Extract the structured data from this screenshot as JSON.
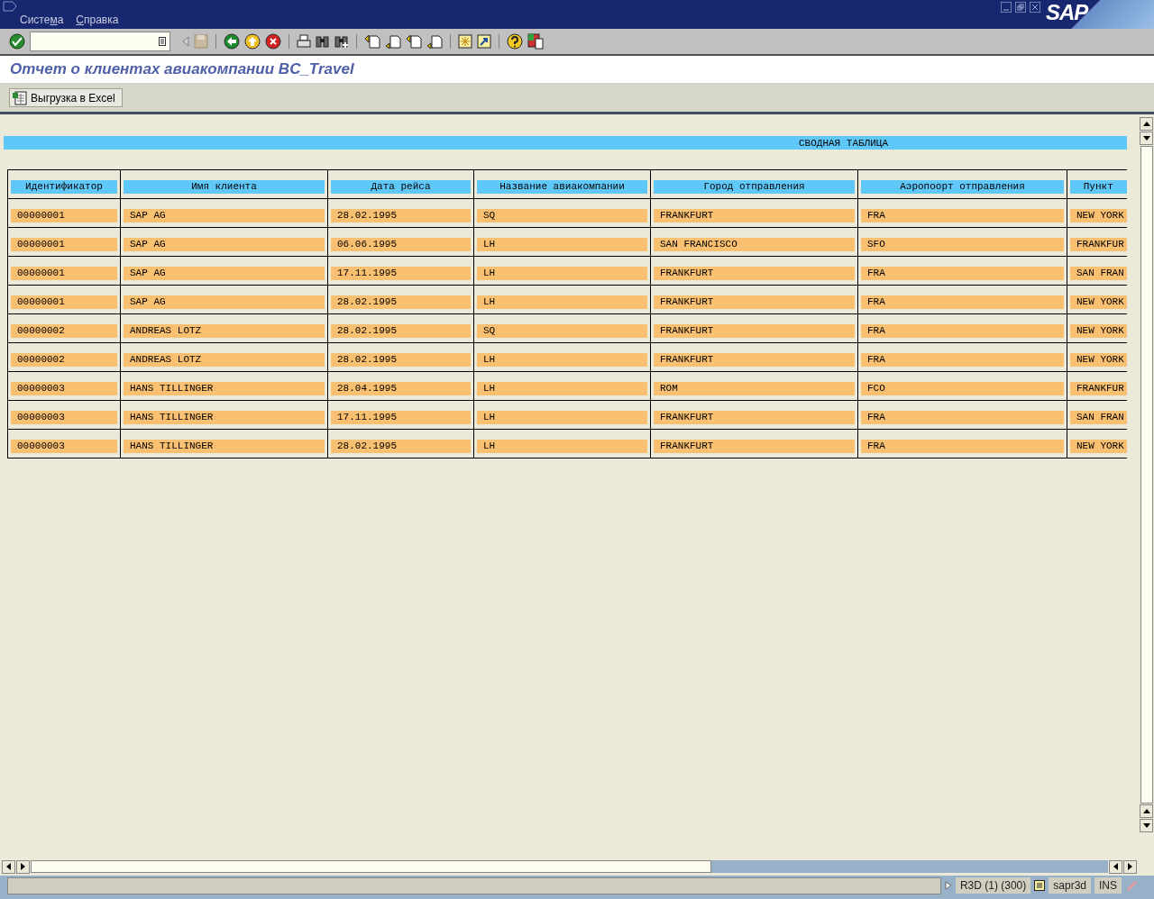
{
  "menu": [
    {
      "label": "Система"
    },
    {
      "label": "Справка"
    }
  ],
  "logo": "SAP",
  "title": "Отчет о клиентах авиакомпании BC_Travel",
  "app_button": "Выгрузка в Excel",
  "banner": "СВОДНАЯ ТАБЛИЦА",
  "table": {
    "columns": [
      "Идентификатор",
      "Имя клиента",
      "Дата рейса",
      "Название авиакомпании",
      "Город отправления",
      "Аэропоорт отправления",
      "Пункт"
    ],
    "rows": [
      [
        "00000001",
        "SAP AG",
        "28.02.1995",
        "SQ",
        "FRANKFURT",
        "FRA",
        "NEW YORK"
      ],
      [
        "00000001",
        "SAP AG",
        "06.06.1995",
        "LH",
        "SAN FRANCISCO",
        "SFO",
        "FRANKFUR"
      ],
      [
        "00000001",
        "SAP AG",
        "17.11.1995",
        "LH",
        "FRANKFURT",
        "FRA",
        "SAN FRAN"
      ],
      [
        "00000001",
        "SAP AG",
        "28.02.1995",
        "LH",
        "FRANKFURT",
        "FRA",
        "NEW YORK"
      ],
      [
        "00000002",
        "ANDREAS LOTZ",
        "28.02.1995",
        "SQ",
        "FRANKFURT",
        "FRA",
        "NEW YORK"
      ],
      [
        "00000002",
        "ANDREAS LOTZ",
        "28.02.1995",
        "LH",
        "FRANKFURT",
        "FRA",
        "NEW YORK"
      ],
      [
        "00000003",
        "HANS TILLINGER",
        "28.04.1995",
        "LH",
        "ROM",
        "FCO",
        "FRANKFUR"
      ],
      [
        "00000003",
        "HANS TILLINGER",
        "17.11.1995",
        "LH",
        "FRANKFURT",
        "FRA",
        "SAN FRAN"
      ],
      [
        "00000003",
        "HANS TILLINGER",
        "28.02.1995",
        "LH",
        "FRANKFURT",
        "FRA",
        "NEW YORK"
      ]
    ]
  },
  "status_bar": {
    "system": "R3D (1) (300)",
    "server": "sapr3d",
    "mode": "INS"
  }
}
